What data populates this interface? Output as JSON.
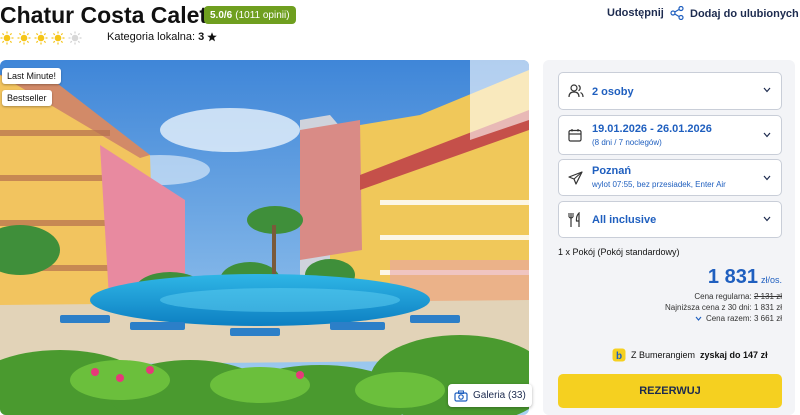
{
  "hotel": {
    "name": "Chatur Costa Caleta",
    "rating_score": "5.0/6",
    "rating_count": "(1011 opinii)",
    "suns_filled": 4,
    "suns_total": 5,
    "category_label": "Kategoria lokalna:",
    "category_value": "3"
  },
  "actions": {
    "share_label": "Udostępnij",
    "favorite_label": "Dodaj do ulubionych"
  },
  "photo": {
    "tags": [
      "Last Minute!",
      "Bestseller"
    ],
    "gallery_label": "Galeria (33)"
  },
  "booking": {
    "guests": "2 osoby",
    "dates": "19.01.2026 - 26.01.2026",
    "nights": "(8 dni / 7 noclegów)",
    "departure_city": "Poznań",
    "departure_details": "wylot 07:55, bez przesiadek, Enter Air",
    "board": "All inclusive",
    "room": "1 x Pokój   (Pokój standardowy)",
    "price_amount": "1 831",
    "price_unit": "zł/os.",
    "regular_label": "Cena regularna:",
    "regular_value": "2 131 zł",
    "lowest_30_days": "Najniższa cena z 30 dni: 1 831 zł",
    "total_label": "Cena razem: 3 661 zł",
    "boomerang_prefix": "Z Bumerangiem",
    "boomerang_bold": "zyskaj do 147 zł",
    "book_button": "REZERWUJ"
  },
  "colors": {
    "accent_blue": "#1f5fbf",
    "rating_green": "#6f9f1f",
    "book_yellow": "#f5d020",
    "sun_yellow": "#f5c518"
  }
}
